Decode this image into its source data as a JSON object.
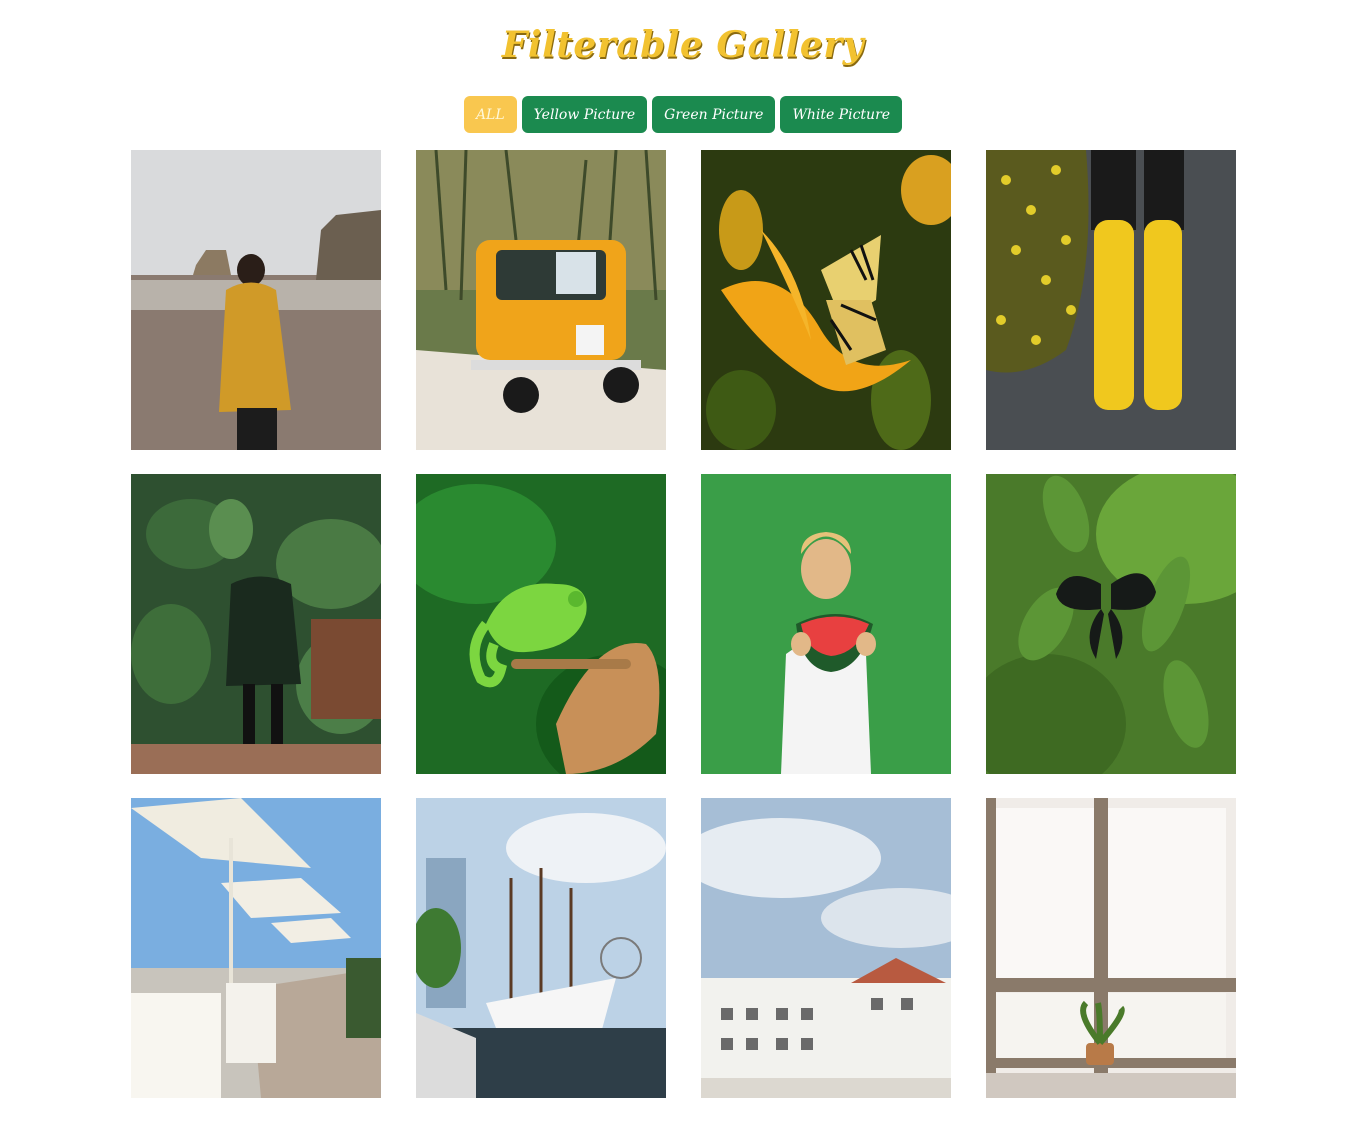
{
  "header": {
    "title": "Filterable Gallery"
  },
  "filters": [
    {
      "label": "ALL",
      "active": true
    },
    {
      "label": "Yellow Picture",
      "active": false
    },
    {
      "label": "Green Picture",
      "active": false
    },
    {
      "label": "White Picture",
      "active": false
    }
  ],
  "colors": {
    "title": "#f2c230",
    "button_active": "#f9c74f",
    "button_inactive": "#1b8a4f"
  },
  "gallery": {
    "items": [
      {
        "subject": "woman in yellow jacket on beach",
        "category": "yellow"
      },
      {
        "subject": "yellow vintage car",
        "category": "yellow"
      },
      {
        "subject": "butterfly on yellow lily",
        "category": "yellow"
      },
      {
        "subject": "yellow rain boots",
        "category": "yellow"
      },
      {
        "subject": "woman among large green leaves",
        "category": "green"
      },
      {
        "subject": "green chameleon on hand",
        "category": "green"
      },
      {
        "subject": "child eating watermelon on green background",
        "category": "green"
      },
      {
        "subject": "black butterfly on green leaves",
        "category": "green"
      },
      {
        "subject": "white umbrellas on terrace",
        "category": "white"
      },
      {
        "subject": "white tall ship in harbor",
        "category": "white"
      },
      {
        "subject": "white seaside buildings",
        "category": "white"
      },
      {
        "subject": "white window with potted plant",
        "category": "white"
      }
    ]
  }
}
